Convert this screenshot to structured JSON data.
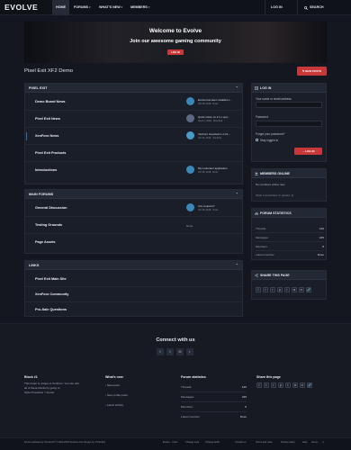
{
  "nav": {
    "logo": "EVOLVE",
    "items": [
      "HOME",
      "FORUMS",
      "WHAT'S NEW",
      "MEMBERS"
    ],
    "login": "LOG IN",
    "search": "SEARCH",
    "caret": "▾"
  },
  "banner": {
    "title": "Welcome to Evolve",
    "subtitle": "Join our awesome gaming community",
    "button": "LOG IN"
  },
  "page": {
    "title": "Pixel Exit XF2 Demo",
    "new_posts": "NEW POSTS"
  },
  "categories": [
    {
      "title": "PIXEL EXIT",
      "nodes": [
        {
          "name": "Demo Board News",
          "last_title": "Evolve has been installed o...",
          "last_meta": "Oct 28, 2018 · Russ"
        },
        {
          "name": "Pixel Exit News",
          "last_title": "Quick notice on 2.1.x upd...",
          "last_meta": "Sep 11, 2019 · Pixel Exit"
        },
        {
          "name": "XenForo News",
          "last_title": "XenForo Important 1.2.x/1...",
          "last_meta": "Oct 31, 2019 · XenForo"
        },
        {
          "name": "Pixel Exit Products",
          "last_title": "",
          "last_meta": ""
        },
        {
          "name": "Introductions",
          "last_title": "My moderator application",
          "last_meta": "Oct 28, 2018 · Russ"
        }
      ]
    },
    {
      "title": "MAIN FORUMS",
      "nodes": [
        {
          "name": "General Discussion",
          "last_title": "Any coupons?",
          "last_meta": "Oct 28, 2018 · Russ"
        },
        {
          "name": "Testing Grounds",
          "none": "None"
        },
        {
          "name": "Page Assets"
        }
      ]
    },
    {
      "title": "LINKS",
      "nodes": [
        {
          "name": "Pixel Exit Main Site"
        },
        {
          "name": "XenForo Community"
        },
        {
          "name": "Pro-Sale Questions"
        }
      ]
    }
  ],
  "collapse_icon": "⌃",
  "sidebar": {
    "login": {
      "title": "LOG IN",
      "user_label": "Your name or email address",
      "password_label": "Password",
      "forgot": "Forgot your password?",
      "stay": "Stay logged in",
      "button": "LOG IN"
    },
    "members": {
      "title": "MEMBERS ONLINE",
      "none": "No members online now.",
      "total": "Total: 1 (members: 0, guests: 1)"
    },
    "stats": {
      "title": "FORUM STATISTICS",
      "rows": [
        {
          "label": "Threads",
          "value": "126"
        },
        {
          "label": "Messages",
          "value": "225"
        },
        {
          "label": "Members",
          "value": "8"
        },
        {
          "label": "Latest member",
          "value": "Dove"
        }
      ]
    },
    "share": {
      "title": "SHARE THIS PAGE",
      "icons": [
        "f",
        "t",
        "r",
        "p",
        "t",
        "w",
        "✉",
        "🔗"
      ]
    }
  },
  "footer": {
    "connect_title": "Connect with us",
    "connect_icons": [
      "f",
      "t",
      "✉",
      "r"
    ],
    "block1": {
      "title": "Block #1",
      "lines": [
        "This footer is unique to XenForo. You can edit",
        "all of these blocks by going to",
        "Style Properties > Footer."
      ]
    },
    "whats_new": {
      "title": "What's new",
      "items": [
        "New posts",
        "New profile posts",
        "Latest activity"
      ]
    },
    "stats": {
      "title": "Forum statistics",
      "rows": [
        {
          "label": "Threads:",
          "value": "126"
        },
        {
          "label": "Messages:",
          "value": "225"
        },
        {
          "label": "Members:",
          "value": "8"
        },
        {
          "label": "Latest member:",
          "value": "Dove"
        }
      ]
    },
    "share": {
      "title": "Share this page"
    },
    "bottom_left": "Forum software by XenForo® © 2010-2019 XenForo Ltd. Design by: Pixel Exit",
    "bottom_links": [
      "Evolve · Color ·",
      "Change style",
      "Change width",
      "Contact us",
      "Terms and rules",
      "Privacy policy",
      "Help",
      "Home"
    ]
  },
  "colors": {
    "accent": "#c93838",
    "background": "#14171f",
    "panel": "#1a1e28"
  }
}
